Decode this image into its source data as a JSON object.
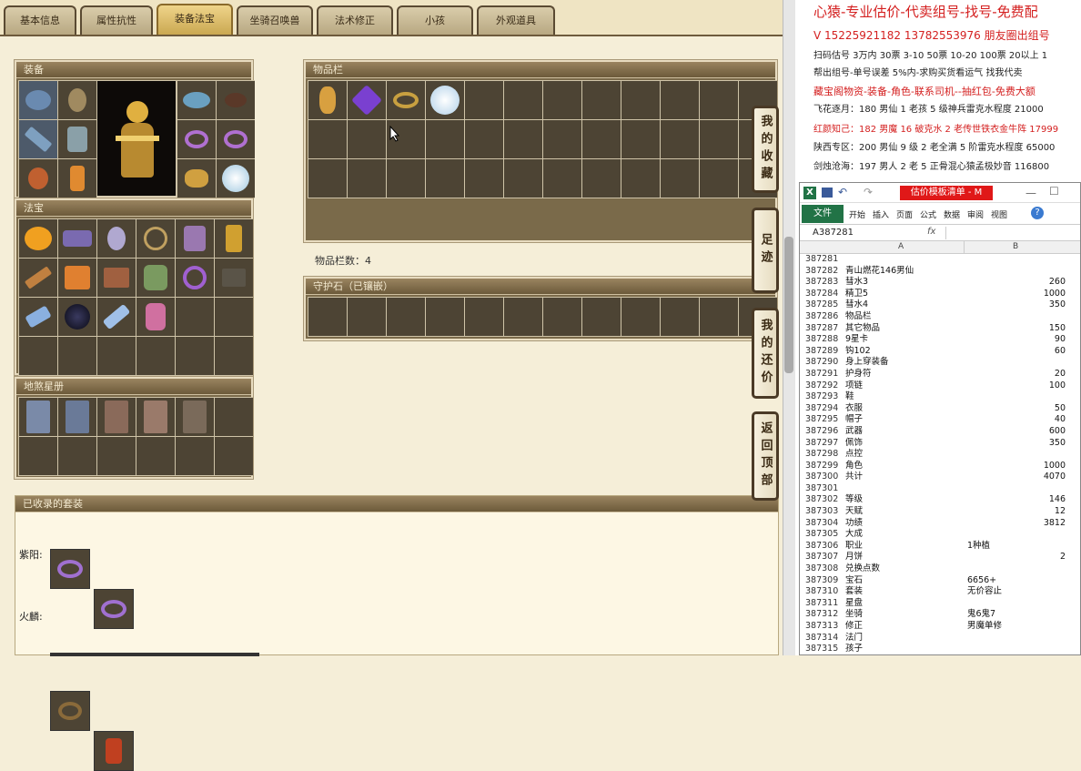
{
  "tabs": [
    {
      "label": "基本信息",
      "active": false
    },
    {
      "label": "属性抗性",
      "active": false
    },
    {
      "label": "装备法宝",
      "active": true
    },
    {
      "label": "坐骑召唤兽",
      "active": false
    },
    {
      "label": "法术修正",
      "active": false
    },
    {
      "label": "小孩",
      "active": false
    },
    {
      "label": "外观道具",
      "active": false
    }
  ],
  "panels": {
    "equipment": {
      "title": "装备"
    },
    "fabao": {
      "title": "法宝"
    },
    "constellation": {
      "title": "地煞星册"
    },
    "inventory": {
      "title": "物品栏",
      "count_text": "物品栏数：4"
    },
    "guard": {
      "title": "守护石（已镶嵌）"
    },
    "sets": {
      "title": "已收录的套装",
      "rows": [
        {
          "label": "紫阳:"
        },
        {
          "label": "火麟:"
        }
      ]
    }
  },
  "side_buttons": [
    "我的收藏",
    "足迹",
    "我的还价",
    "返回顶部"
  ],
  "ad": {
    "title": "心猿-专业估价-代卖组号-找号-免费配",
    "phone": "V 15225921182   13782553976 朋友圈出组号",
    "lines": [
      {
        "text": "扫码估号 3万内 30票 3-10 50票 10-20 100票 20以上 1",
        "color": "#222"
      },
      {
        "text": "帮出组号-单号误差 5%内-求购买货看运气 找我代卖",
        "color": "#222"
      },
      {
        "text": "藏宝阁物资-装备-角色-联系司机--抽红包-免费大额",
        "color": "#d42020"
      },
      {
        "text": "飞花逐月：180 男仙 1 老孩 5 级神兵雷克水程度 21000",
        "color": "#222"
      },
      {
        "text": "红颜知己：182 男魔 16 破克水 2 老传世铁衣金牛阵 17999",
        "color": "#d42020"
      },
      {
        "text": "陕西专区：200 男仙 9 级 2 老全满 5 阶雷克水程度 65000",
        "color": "#222"
      },
      {
        "text": "剑烛沧海：197 男人 2 老 5 正骨混心猿孟极妙音 116800",
        "color": "#222"
      }
    ]
  },
  "excel": {
    "title": "估价模板清单 - M",
    "ribbon_tabs": [
      "文件",
      "开始",
      "插入",
      "页面",
      "公式",
      "数据",
      "审阅",
      "视图"
    ],
    "cell_ref": "A387281",
    "fx": "fx",
    "col_a": "A",
    "col_b": "B",
    "rows": [
      {
        "n": "387281",
        "a": "",
        "b": ""
      },
      {
        "n": "387282",
        "a": "青山燃花146男仙",
        "b": ""
      },
      {
        "n": "387283",
        "a": "彗水3",
        "b": "260"
      },
      {
        "n": "387284",
        "a": "精卫5",
        "b": "1000"
      },
      {
        "n": "387285",
        "a": "彗水4",
        "b": "350"
      },
      {
        "n": "387286",
        "a": "物品栏",
        "b": ""
      },
      {
        "n": "387287",
        "a": "其它物品",
        "b": "150"
      },
      {
        "n": "387288",
        "a": "9星卡",
        "b": "90"
      },
      {
        "n": "387289",
        "a": "钩102",
        "b": "60"
      },
      {
        "n": "387290",
        "a": "身上穿装备",
        "b": ""
      },
      {
        "n": "387291",
        "a": "护身符",
        "b": "20"
      },
      {
        "n": "387292",
        "a": "项链",
        "b": "100"
      },
      {
        "n": "387293",
        "a": "鞋",
        "b": ""
      },
      {
        "n": "387294",
        "a": "衣服",
        "b": "50"
      },
      {
        "n": "387295",
        "a": "帽子",
        "b": "40"
      },
      {
        "n": "387296",
        "a": "武器",
        "b": "600"
      },
      {
        "n": "387297",
        "a": "佩饰",
        "b": "350"
      },
      {
        "n": "387298",
        "a": "点控",
        "b": ""
      },
      {
        "n": "387299",
        "a": "角色",
        "b": "1000"
      },
      {
        "n": "387300",
        "a": "共计",
        "b": "4070"
      },
      {
        "n": "387301",
        "a": "",
        "b": ""
      },
      {
        "n": "387302",
        "a": "等级",
        "b": "146"
      },
      {
        "n": "387303",
        "a": "天赋",
        "b": "12"
      },
      {
        "n": "387304",
        "a": "功绩",
        "b": "3812"
      },
      {
        "n": "387305",
        "a": "大成",
        "b": ""
      },
      {
        "n": "387306",
        "a": "职业",
        "b": "1种植"
      },
      {
        "n": "387307",
        "a": "月饼",
        "b": "2"
      },
      {
        "n": "387308",
        "a": "兑换点数",
        "b": ""
      },
      {
        "n": "387309",
        "a": "宝石",
        "b": "6656+"
      },
      {
        "n": "387310",
        "a": "套装",
        "b": "无价容止"
      },
      {
        "n": "387311",
        "a": "星盘",
        "b": ""
      },
      {
        "n": "387312",
        "a": "坐骑",
        "b": "鬼6鬼7"
      },
      {
        "n": "387313",
        "a": "修正",
        "b": "男魔单修"
      },
      {
        "n": "387314",
        "a": "法门",
        "b": ""
      },
      {
        "n": "387315",
        "a": "孩子",
        "b": ""
      }
    ]
  },
  "colors": {
    "accent": "#caa851",
    "panel": "#7a6a4a",
    "cell": "#4d4434",
    "excel_green": "#217346",
    "ad_red": "#d42020"
  }
}
